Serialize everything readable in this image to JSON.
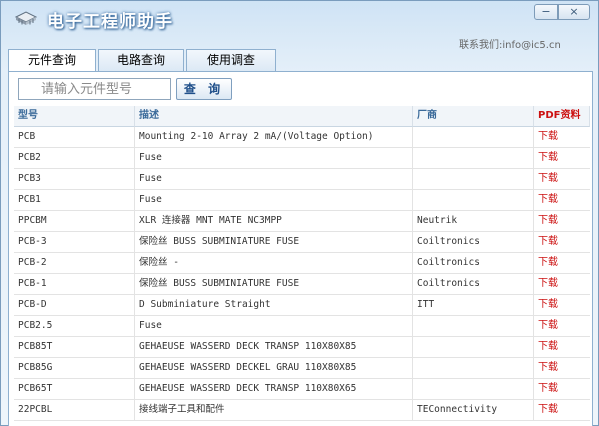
{
  "window": {
    "title": "电子工程师助手",
    "minimize_glyph": "−",
    "close_glyph": "×",
    "contact": "联系我们:info@ic5.cn"
  },
  "tabs": [
    {
      "label": "元件查询",
      "active": true
    },
    {
      "label": "电路查询",
      "active": false
    },
    {
      "label": "使用调查",
      "active": false
    }
  ],
  "search": {
    "placeholder": "请输入元件型号",
    "value": "",
    "button_label": "查 询"
  },
  "table": {
    "columns": [
      "型号",
      "描述",
      "厂商",
      "PDF资料"
    ],
    "rows": [
      {
        "part": "PCB",
        "desc": "Mounting 2-10 Array 2 mA/(Voltage Option)",
        "mfr": "",
        "pdf": "下载"
      },
      {
        "part": "PCB2",
        "desc": "Fuse",
        "mfr": "",
        "pdf": "下载"
      },
      {
        "part": "PCB3",
        "desc": "Fuse",
        "mfr": "",
        "pdf": "下载"
      },
      {
        "part": "PCB1",
        "desc": "Fuse",
        "mfr": "",
        "pdf": "下载"
      },
      {
        "part": "PPCBM",
        "desc": "XLR 连接器 MNT MATE NC3MPP",
        "mfr": "Neutrik",
        "pdf": "下载"
      },
      {
        "part": "PCB-3",
        "desc": "保险丝 BUSS SUBMINIATURE FUSE",
        "mfr": "Coiltronics",
        "pdf": "下载"
      },
      {
        "part": "PCB-2",
        "desc": "保险丝 -",
        "mfr": "Coiltronics",
        "pdf": "下载"
      },
      {
        "part": "PCB-1",
        "desc": "保险丝 BUSS SUBMINIATURE FUSE",
        "mfr": "Coiltronics",
        "pdf": "下载"
      },
      {
        "part": "PCB-D",
        "desc": "D Subminiature Straight",
        "mfr": "ITT",
        "pdf": "下载"
      },
      {
        "part": "PCB2.5",
        "desc": "Fuse",
        "mfr": "",
        "pdf": "下载"
      },
      {
        "part": "PCB85T",
        "desc": "GEHAEUSE WASSERD DECK TRANSP 110X80X85",
        "mfr": "",
        "pdf": "下载"
      },
      {
        "part": "PCB85G",
        "desc": "GEHAEUSE WASSERD DECKEL GRAU 110X80X85",
        "mfr": "",
        "pdf": "下载"
      },
      {
        "part": "PCB65T",
        "desc": "GEHAEUSE WASSERD DECK TRANSP 110X80X65",
        "mfr": "",
        "pdf": "下载"
      },
      {
        "part": "22PCBL",
        "desc": "接线端子工具和配件",
        "mfr": "TEConnectivity",
        "pdf": "下载"
      }
    ]
  },
  "colors": {
    "accent": "#3a6a9a",
    "download_link": "#cc1010",
    "frame": "#7a9cbd"
  },
  "icons": {
    "app": "chip-icon"
  }
}
